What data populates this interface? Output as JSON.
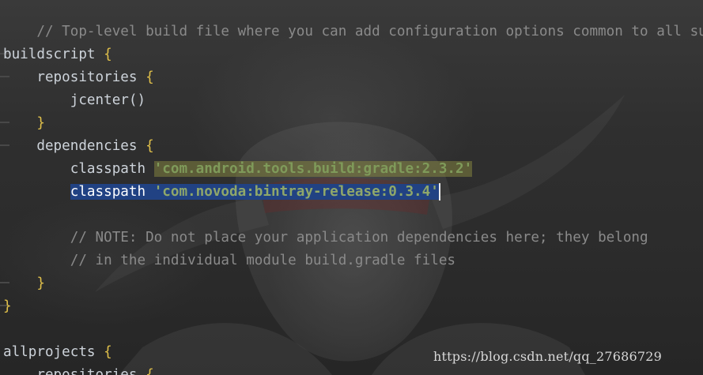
{
  "editor": {
    "lines": {
      "l1": {
        "comment": "// Top-level build file where you can add configuration options common to all sub"
      },
      "l2": {
        "keyword": "buildscript",
        "brace": "{"
      },
      "l3": {
        "keyword": "repositories",
        "brace": "{"
      },
      "l4": {
        "call": "jcenter()"
      },
      "l5": {
        "brace": "}"
      },
      "l6": {
        "keyword": "dependencies",
        "brace": "{"
      },
      "l7": {
        "keyword": "classpath",
        "string": "'com.android.tools.build:gradle:2.3.2'"
      },
      "l8": {
        "keyword": "classpath",
        "string": "'com.novoda:bintray-release:0.3.4'"
      },
      "l9": {
        "comment": "// NOTE: Do not place your application dependencies here; they belong"
      },
      "l10": {
        "comment": "// in the individual module build.gradle files"
      },
      "l11": {
        "brace": "}"
      },
      "l12": {
        "brace": "}"
      },
      "l13": {
        "keyword": "allprojects",
        "brace": "{"
      },
      "l14": {
        "keyword": "repositories",
        "brace": "{"
      }
    }
  },
  "watermark": "https://blog.csdn.net/qq_27686729",
  "colors": {
    "background": "#2b2b2b",
    "comment": "#8a8a8a",
    "brace": "#e0c04a",
    "string": "#7f9a5a",
    "selection": "#214283",
    "usage_highlight": "#6c6c3a"
  },
  "icons": [
    "background-figure-art"
  ]
}
